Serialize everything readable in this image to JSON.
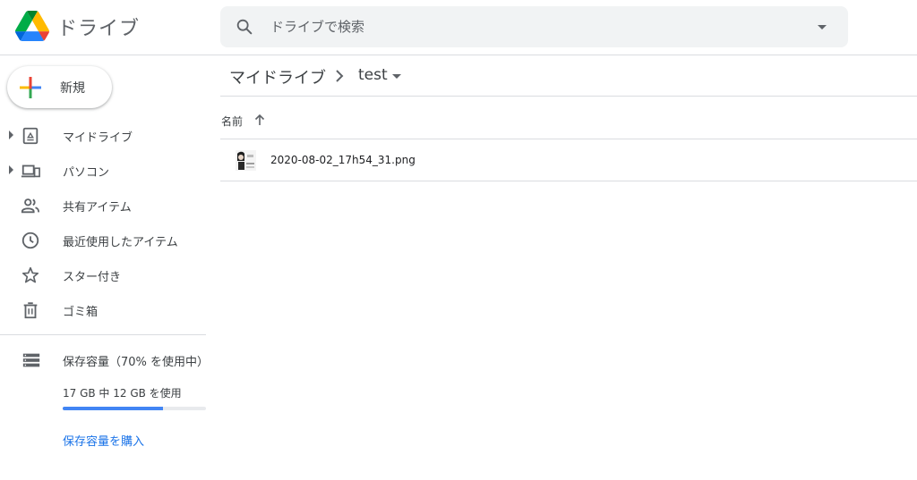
{
  "header": {
    "app_title": "ドライブ",
    "search_placeholder": "ドライブで検索"
  },
  "sidebar": {
    "new_label": "新規",
    "items": [
      {
        "label": "マイドライブ",
        "icon": "my-drive-icon",
        "expandable": true
      },
      {
        "label": "パソコン",
        "icon": "computers-icon",
        "expandable": true
      },
      {
        "label": "共有アイテム",
        "icon": "shared-people-icon",
        "expandable": false
      },
      {
        "label": "最近使用したアイテム",
        "icon": "clock-icon",
        "expandable": false
      },
      {
        "label": "スター付き",
        "icon": "star-icon",
        "expandable": false
      },
      {
        "label": "ゴミ箱",
        "icon": "trash-icon",
        "expandable": false
      }
    ],
    "storage": {
      "title": "保存容量（70% を使用中）",
      "detail": "17 GB 中 12 GB を使用",
      "used_fraction": 0.7,
      "buy_label": "保存容量を購入"
    }
  },
  "breadcrumb": {
    "root": "マイドライブ",
    "current": "test"
  },
  "list": {
    "column_name": "名前",
    "files": [
      {
        "name": "2020-08-02_17h54_31.png"
      }
    ]
  },
  "colors": {
    "accent": "#1a73e8",
    "storage_bar": "#4285f4",
    "search_bg": "#f1f3f4"
  }
}
